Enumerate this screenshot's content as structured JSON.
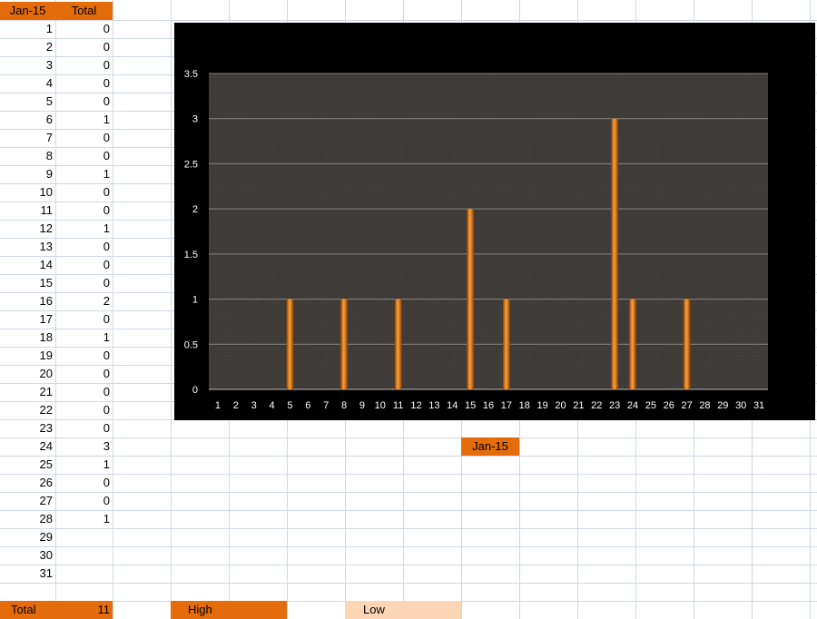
{
  "sheet": {
    "header_day": "Jan-15",
    "header_total": "Total",
    "days": [
      "1",
      "2",
      "3",
      "4",
      "5",
      "6",
      "7",
      "8",
      "9",
      "10",
      "11",
      "12",
      "13",
      "14",
      "15",
      "16",
      "17",
      "18",
      "19",
      "20",
      "21",
      "22",
      "23",
      "24",
      "25",
      "26",
      "27",
      "28",
      "29",
      "30",
      "31"
    ],
    "totals": [
      "0",
      "0",
      "0",
      "0",
      "0",
      "1",
      "0",
      "0",
      "1",
      "0",
      "0",
      "1",
      "0",
      "0",
      "0",
      "2",
      "0",
      "1",
      "0",
      "0",
      "0",
      "0",
      "0",
      "3",
      "1",
      "0",
      "0",
      "1",
      "",
      "",
      ""
    ],
    "footer_label": "Total",
    "footer_value": "11",
    "high_label": "High",
    "low_label": "Low",
    "chart_caption": "Jan-15"
  },
  "colors": {
    "highlight": "#e46c0a",
    "low_fill": "#fcd5b4",
    "gridline": "#d0d7e5",
    "plot_bg": "#3d3a37",
    "chart_bg": "#000000",
    "bar": "#f08a1f"
  },
  "chart_data": {
    "type": "bar",
    "categories": [
      "1",
      "2",
      "3",
      "4",
      "5",
      "6",
      "7",
      "8",
      "9",
      "10",
      "11",
      "12",
      "13",
      "14",
      "15",
      "16",
      "17",
      "18",
      "19",
      "20",
      "21",
      "22",
      "23",
      "24",
      "25",
      "26",
      "27",
      "28",
      "29",
      "30",
      "31"
    ],
    "values": [
      0,
      0,
      0,
      0,
      1,
      0,
      0,
      1,
      0,
      0,
      1,
      0,
      0,
      0,
      2,
      0,
      1,
      0,
      0,
      0,
      0,
      0,
      3,
      1,
      0,
      0,
      1,
      0,
      0,
      0,
      0
    ],
    "ylim": [
      0,
      3.5
    ],
    "yticks": [
      "0",
      "0.5",
      "1",
      "1.5",
      "2",
      "2.5",
      "3",
      "3.5"
    ],
    "grid": true,
    "legend": "none"
  }
}
